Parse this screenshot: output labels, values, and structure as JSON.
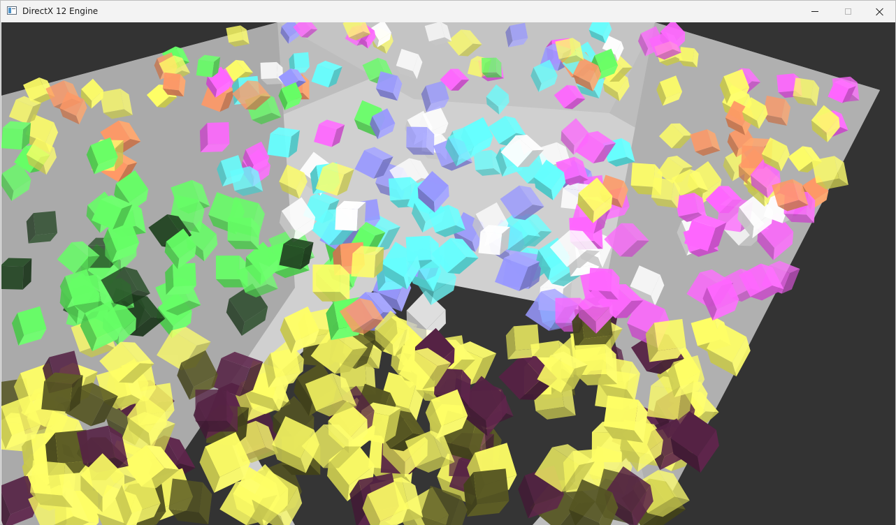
{
  "window": {
    "title": "DirectX 12 Engine",
    "icon": "app-window-icon",
    "controls": [
      "minimize-icon",
      "maximize-icon",
      "close-icon"
    ]
  },
  "colors": {
    "titlebar_bg": "#f3f3f3",
    "viewport_bg": "#333333",
    "floor": "#c8c8c8",
    "walls": "#b4b4b4"
  },
  "scene": {
    "description_visible_text": "",
    "cube_palette": [
      "#ffff66",
      "#ff66ff",
      "#66ffff",
      "#66ff66",
      "#ffffff",
      "#ff9966",
      "#9999ff",
      "#555522",
      "#552244",
      "#224422"
    ]
  }
}
